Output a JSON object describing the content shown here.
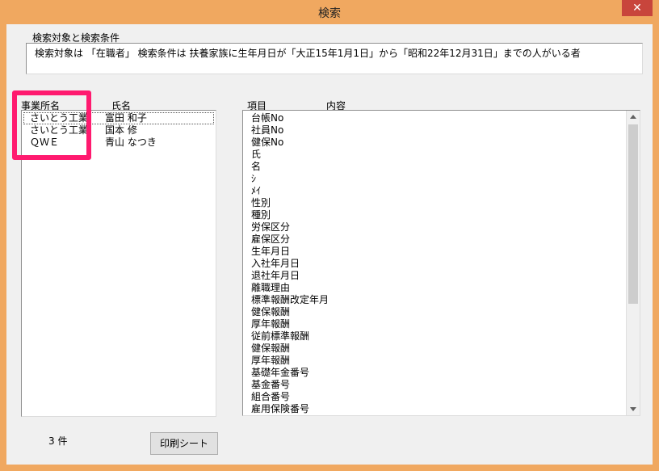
{
  "window": {
    "title": "検索",
    "close": "✕"
  },
  "condition": {
    "label": "検索対象と検索条件",
    "text": "検索対象は 「在職者」 検索条件は 扶養家族に生年月日が「大正15年1月1日」から「昭和22年12月31日」までの人がいる者"
  },
  "results": {
    "headers": [
      "事業所名",
      "氏名"
    ],
    "rows": [
      {
        "office": "さいとう工業",
        "name": "富田 和子"
      },
      {
        "office": "さいとう工業",
        "name": "国本 修"
      },
      {
        "office": "ＱＷＥ",
        "name": "青山 なつき"
      }
    ],
    "count_label": "3 件"
  },
  "detail": {
    "headers": [
      "項目",
      "内容"
    ],
    "items": [
      "台帳No",
      "社員No",
      "健保No",
      "氏",
      "名",
      "ｼ",
      "ﾒｲ",
      "性別",
      "種別",
      "労保区分",
      "雇保区分",
      "生年月日",
      "入社年月日",
      "退社年月日",
      "離職理由",
      "標準報酬改定年月",
      "健保報酬",
      "厚年報酬",
      "従前標準報酬",
      "健保報酬",
      "厚年報酬",
      "基礎年金番号",
      "基金番号",
      "組合番号",
      "雇用保険番号"
    ]
  },
  "actions": {
    "print_label": "印刷シート"
  },
  "colors": {
    "highlight": "#ff1a6f",
    "titlebar": "#f0a860",
    "close": "#c8453c"
  }
}
